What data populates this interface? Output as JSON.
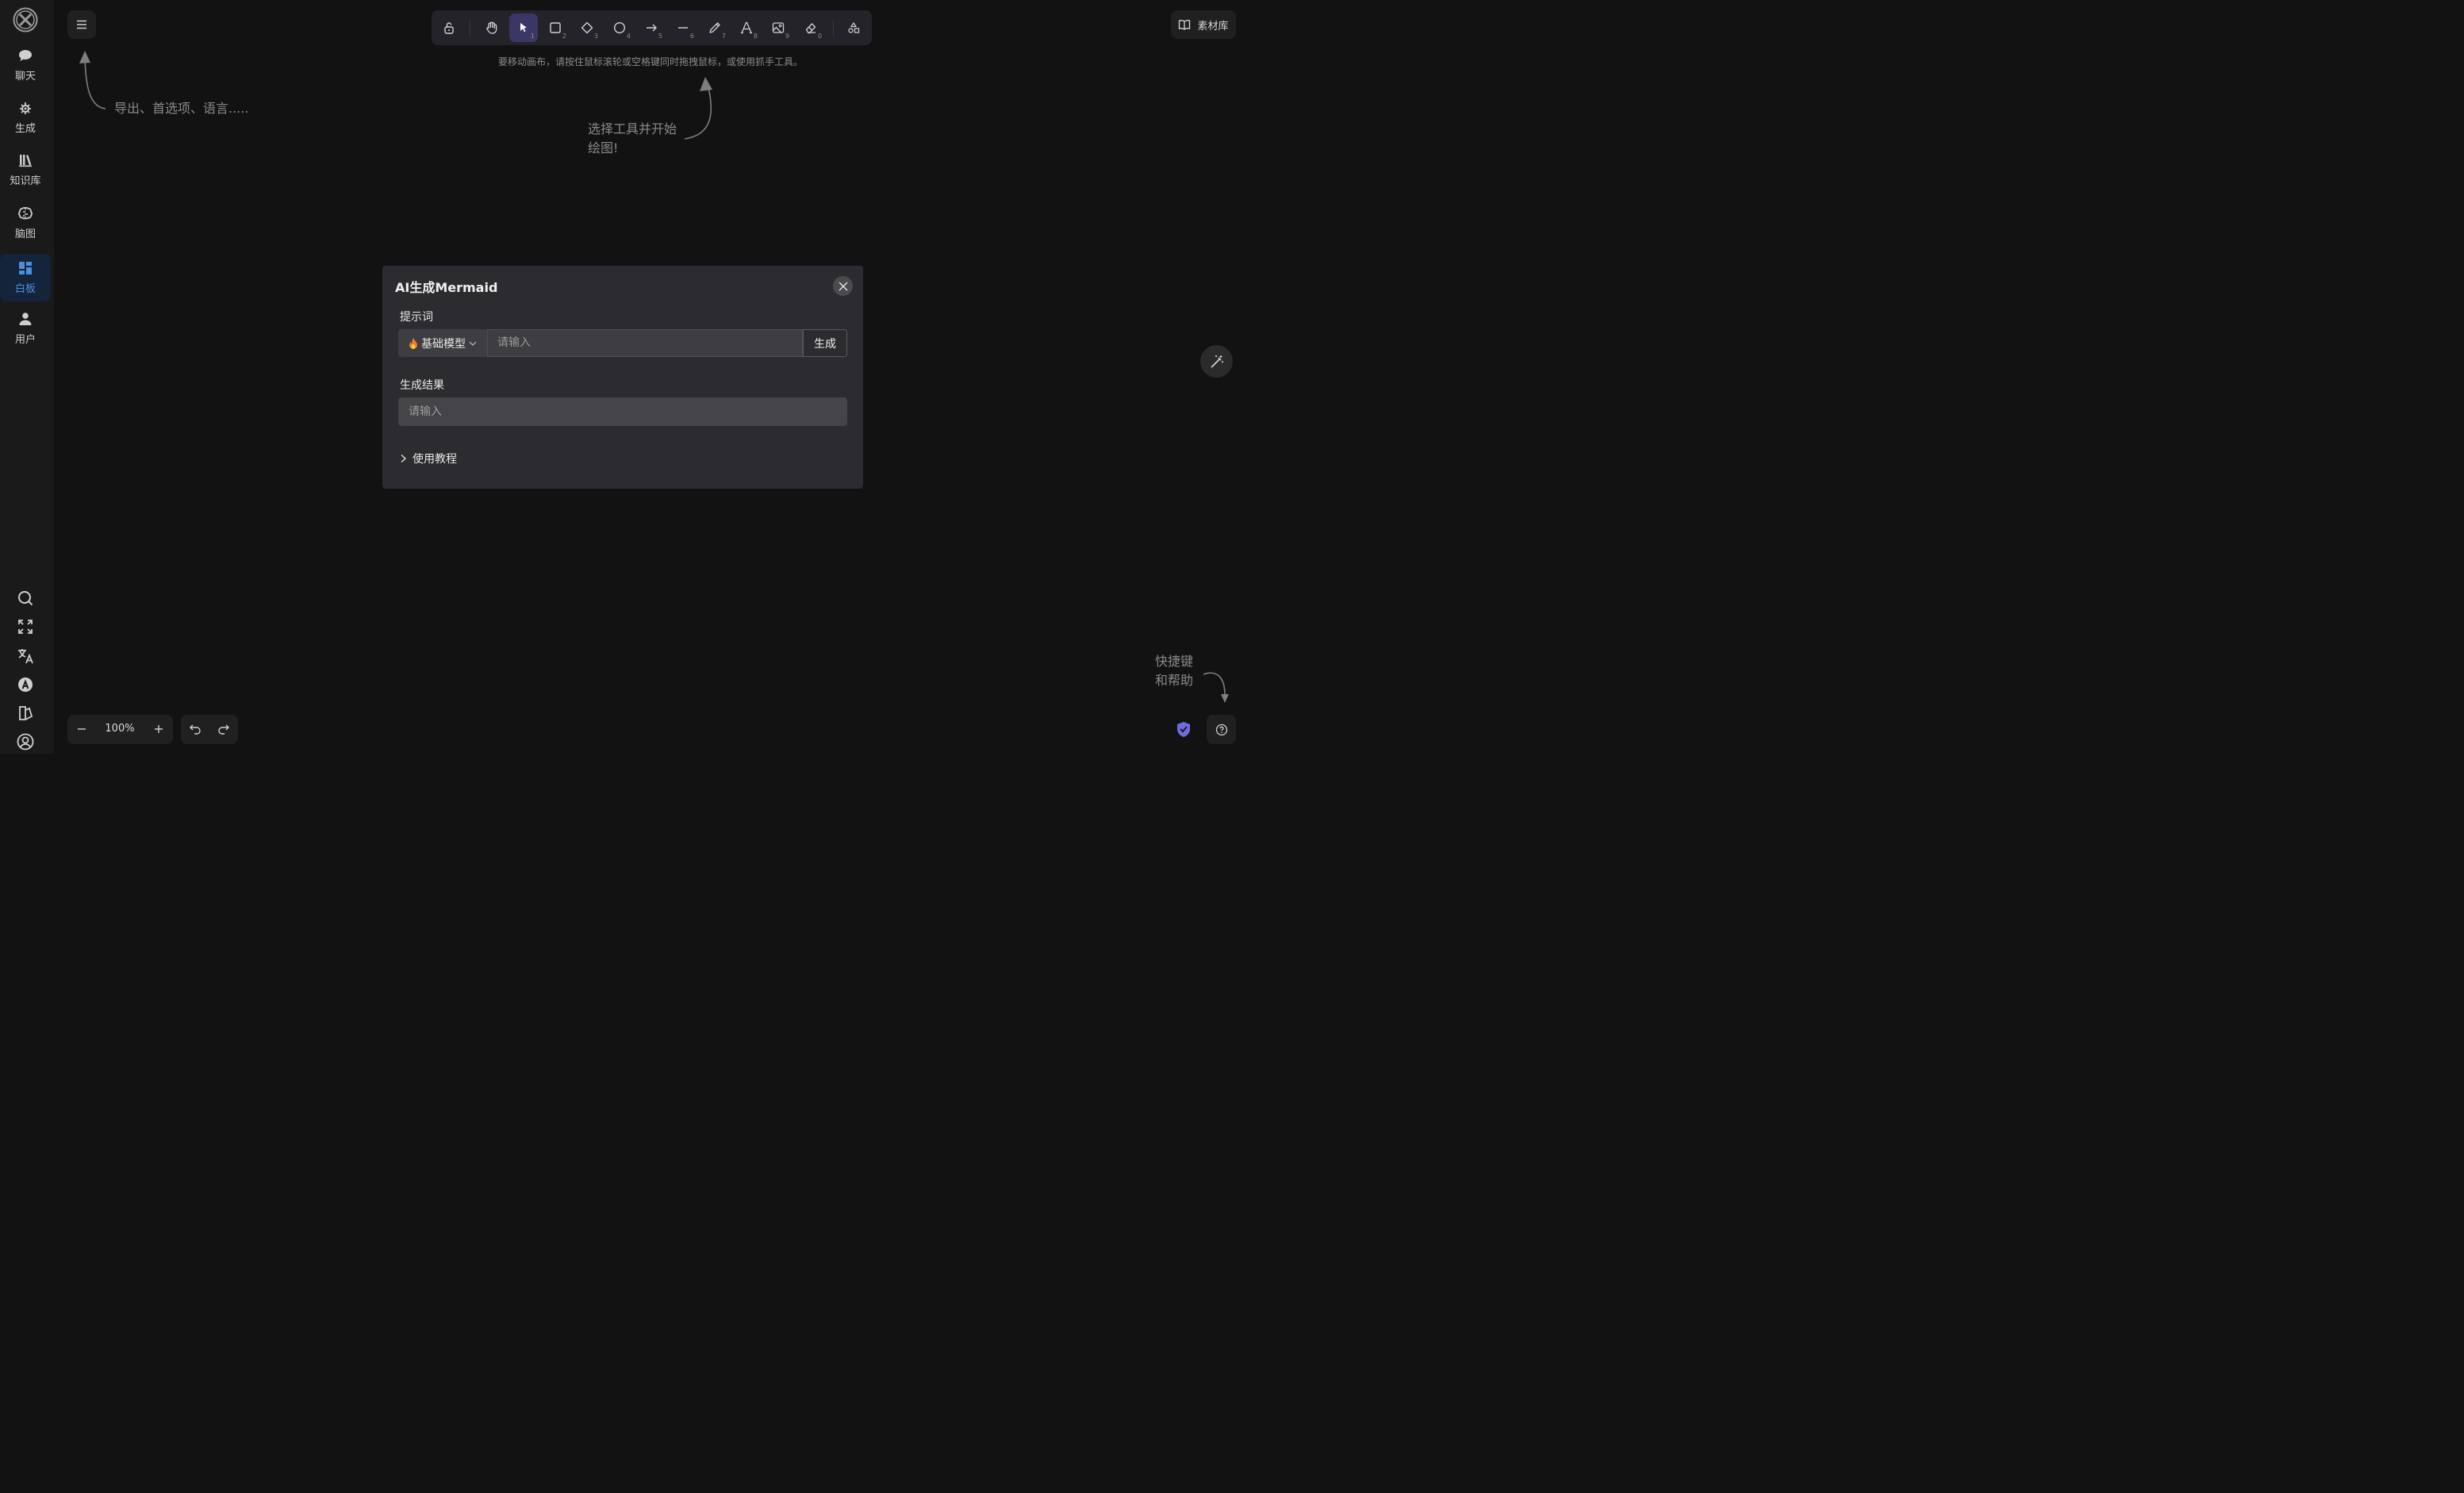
{
  "sidebar": {
    "items": [
      {
        "label": "聊天",
        "icon": "chat-bubble-icon"
      },
      {
        "label": "生成",
        "icon": "sparkle-gear-icon"
      },
      {
        "label": "知识库",
        "icon": "books-icon"
      },
      {
        "label": "脑图",
        "icon": "brain-icon"
      },
      {
        "label": "白板",
        "icon": "dashboard-grid-icon",
        "active": true
      },
      {
        "label": "用户",
        "icon": "user-icon"
      }
    ],
    "bottom_icons": [
      "search-icon",
      "fullscreen-icon",
      "translate-icon",
      "font-a-icon",
      "theme-icon",
      "account-icon"
    ]
  },
  "toolbar": {
    "tools": [
      {
        "name": "lock",
        "shortcut": ""
      },
      {
        "name": "hand",
        "shortcut": ""
      },
      {
        "name": "selection",
        "shortcut": "1"
      },
      {
        "name": "rectangle",
        "shortcut": "2"
      },
      {
        "name": "diamond",
        "shortcut": "3"
      },
      {
        "name": "ellipse",
        "shortcut": "4"
      },
      {
        "name": "arrow",
        "shortcut": "5"
      },
      {
        "name": "line",
        "shortcut": "6"
      },
      {
        "name": "draw",
        "shortcut": "7"
      },
      {
        "name": "text",
        "shortcut": "8"
      },
      {
        "name": "image",
        "shortcut": "9"
      },
      {
        "name": "eraser",
        "shortcut": "0"
      },
      {
        "name": "more-tools",
        "shortcut": ""
      }
    ]
  },
  "canvas_hints": {
    "pan_hint": "要移动画布，请按住鼠标滚轮或空格键同时拖拽鼠标，或使用抓手工具。",
    "menu_hint": "导出、首选项、语言.....",
    "tool_hint_line1": "选择工具并开始",
    "tool_hint_line2": "绘图!",
    "help_hint_line1": "快捷键",
    "help_hint_line2": "和帮助"
  },
  "library_button": {
    "label": "素材库"
  },
  "zoom": {
    "value": "100%"
  },
  "dialog": {
    "title": "AI生成Mermaid",
    "prompt_label": "提示词",
    "model_label": "基础模型",
    "prompt_placeholder": "请输入",
    "generate_label": "生成",
    "result_label": "生成结果",
    "result_placeholder": "请输入",
    "tutorial_label": "使用教程"
  },
  "colors": {
    "background": "#121212",
    "sidebar": "#1a1a1a",
    "active_nav": "#14243a",
    "active_accent": "#4a8fe0",
    "active_tool": "#3a3766",
    "dialog_bg": "#2c2c30"
  }
}
